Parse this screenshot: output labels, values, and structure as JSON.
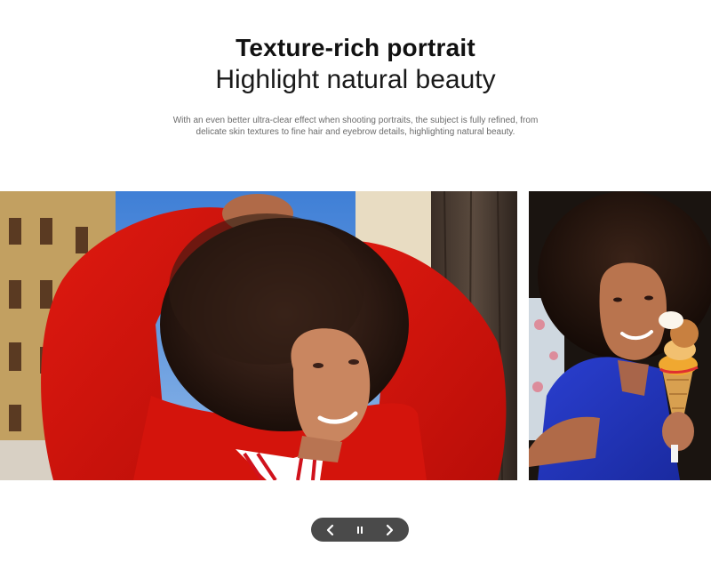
{
  "header": {
    "title": "Texture-rich portrait",
    "subtitle": "Highlight natural beauty",
    "description": "With an even better ultra-clear effect when shooting portraits, the subject is fully refined, from delicate skin textures to fine hair and eyebrow details, highlighting natural beauty."
  },
  "gallery": {
    "slides": [
      {
        "subject": "woman with afro hair in red sweater, arms raised, smiling"
      },
      {
        "subject": "woman with afro hair in blue top holding ice cream cone"
      }
    ]
  },
  "controls": {
    "prev_icon": "chevron-left-icon",
    "pause_icon": "pause-icon",
    "next_icon": "chevron-right-icon"
  },
  "colors": {
    "control_bg": "#4a4a4a",
    "title": "#111111",
    "description": "#6b6b6b"
  }
}
